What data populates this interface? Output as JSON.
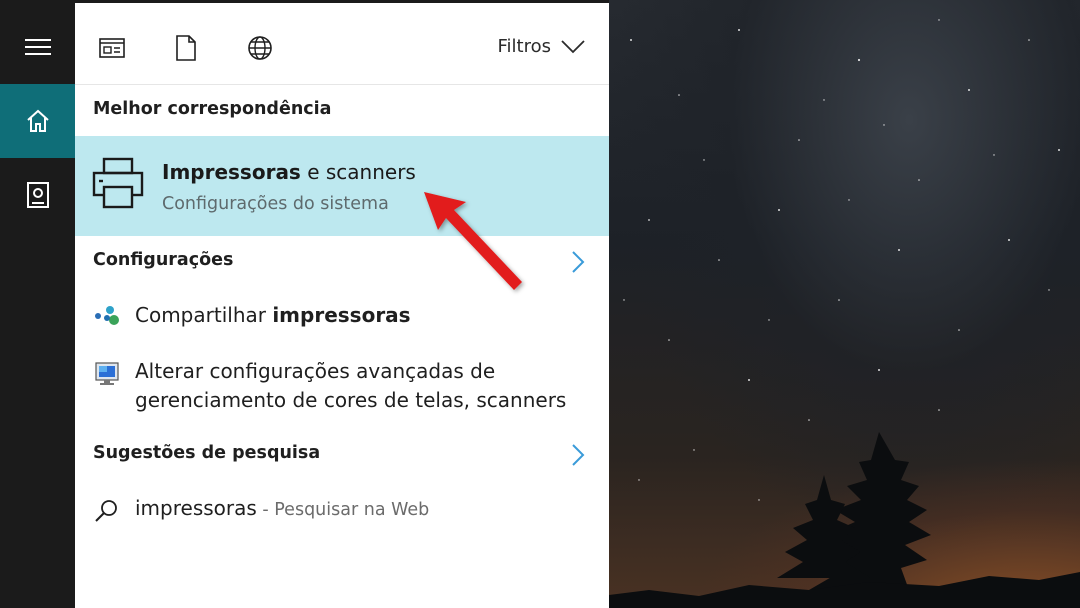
{
  "rail": {
    "items": [
      {
        "icon": "hamburger-menu-icon"
      },
      {
        "icon": "home-icon",
        "active": true,
        "accent": "#0f6e78"
      },
      {
        "icon": "notebook-icon"
      }
    ]
  },
  "topbar": {
    "icons": [
      "apps-icon",
      "documents-icon",
      "web-icon"
    ],
    "filters_label": "Filtros"
  },
  "best_match": {
    "heading": "Melhor correspondência",
    "title_bold": "Impressoras",
    "title_rest": " e scanners",
    "subtitle": "Configurações do sistema",
    "highlight_color": "#bde8ef"
  },
  "settings": {
    "heading": "Configurações",
    "items": [
      {
        "prefix": "Compartilhar ",
        "bold": "impressoras",
        "icon": "network-share-icon"
      },
      {
        "line1": "Alterar configurações avançadas de",
        "line2": "gerenciamento de cores de telas, scanners",
        "icon": "monitor-color-icon"
      }
    ]
  },
  "suggestions": {
    "heading": "Sugestões de pesquisa",
    "items": [
      {
        "query": "impressoras",
        "separator": " - ",
        "hint": "Pesquisar na Web",
        "icon": "search-icon"
      }
    ]
  },
  "annotation": {
    "color": "#e21b1b",
    "icon": "red-arrow-annotation"
  }
}
